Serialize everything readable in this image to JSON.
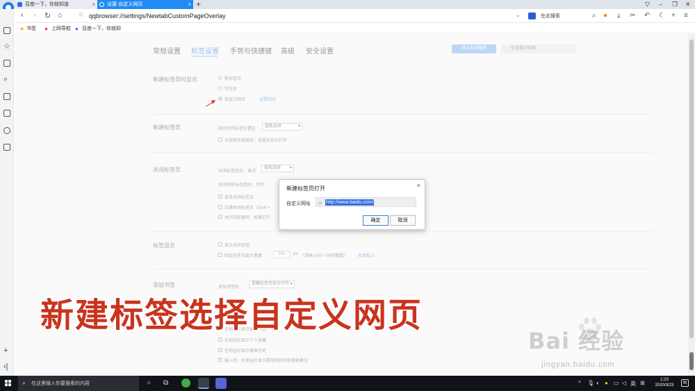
{
  "tabs": [
    {
      "title": "百度一下，你就知道"
    },
    {
      "title": "设置-自定义网页"
    }
  ],
  "address": {
    "url": "qqbrowser://settings/NewtabCustomPageOverlay",
    "search_placeholder": "在此搜索"
  },
  "bookmarks": [
    {
      "label": "书签"
    },
    {
      "label": "上网导航"
    },
    {
      "label": "百度一下，你就知"
    }
  ],
  "settings": {
    "tabs": [
      "常规设置",
      "标签设置",
      "手势与快捷键",
      "高级",
      "安全设置"
    ],
    "active_tab": "标签设置",
    "import_button": "导入IE收藏夹",
    "search_placeholder": "在设置中搜索",
    "section1": {
      "title": "新建标签页时显示",
      "options": [
        "新标签页",
        "空白页",
        "自定义网页"
      ],
      "selected": "自定义网页",
      "link": "设置网页"
    },
    "section2": {
      "title": "新建标签页",
      "label": "网页打开标签位置在",
      "select": "智能选择",
      "checkbox": "点击网页链接时，总是在后台打开"
    },
    "section3": {
      "title": "关闭标签页",
      "label": "关闭标签页后，激活",
      "select": "智能选择",
      "line2": "关闭所有标签页时，打开",
      "checks": [
        "双击关闭标签页",
        "右键关闭标签页（Shift +",
        "关闭浏览器时，如果打开"
      ]
    },
    "section4": {
      "title": "标签显示",
      "check1": "显示关闭按钮",
      "check2": "固定标签页最大宽度",
      "width_value": "240",
      "unit": "px",
      "hint": "（请输入50~700的整数）",
      "reset_link": "恢复默认"
    },
    "section5": {
      "title": "添加书签",
      "label": "添加书签时",
      "select": "提醒标签页后台打开",
      "checks": [
        "在地址栏显示输入内容",
        "在地址栏显示个人收藏",
        "在地址栏显示搜索历史",
        "输入时，在地址栏显示猜测的网页和搜索建议"
      ]
    }
  },
  "dialog": {
    "title": "新建标签页打开",
    "close": "×",
    "label": "自定义网址",
    "value": "http://www.baidu.com/",
    "ok": "确定",
    "cancel": "取消"
  },
  "caption": "新建标签选择自定义网页",
  "watermark": {
    "brand": "Bai  经验",
    "url": "jingyan.baidu.com"
  },
  "taskbar": {
    "search_placeholder": "在这里输入你要搜索的内容",
    "ime": "英",
    "time": "1:23",
    "date": "2020/3/23"
  },
  "colors": {
    "accent": "#1f8bf3",
    "caption": "#c9341f",
    "arrow": "#e5322d"
  }
}
